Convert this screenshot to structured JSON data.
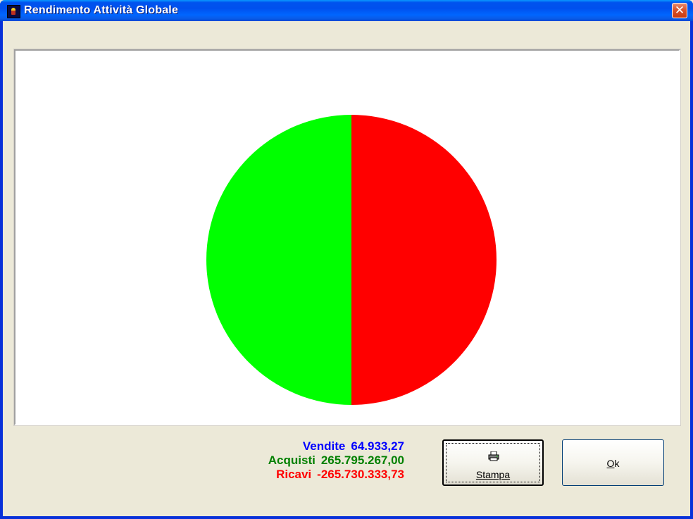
{
  "window": {
    "title": "Rendimento Attività Globale",
    "close_glyph": "✕",
    "colors": {
      "titlebar": "#0050ee",
      "frame": "#0831d9",
      "face": "#ece9d8"
    }
  },
  "chart_data": {
    "type": "pie",
    "labels": [
      "Ricavi",
      "Acquisti"
    ],
    "values": [
      0.5,
      0.5
    ],
    "colors": [
      "#ff0000",
      "#00ff00"
    ]
  },
  "legend": {
    "vendite": {
      "label": "Vendite",
      "value": "64.933,27",
      "color": "#0000ff"
    },
    "acquisti": {
      "label": "Acquisti",
      "value": "265.795.267,00",
      "color": "#008000"
    },
    "ricavi": {
      "label": "Ricavi",
      "value": "-265.730.333,73",
      "color": "#ff0000"
    }
  },
  "buttons": {
    "stampa": {
      "label": "Stampa",
      "icon": "printer-icon"
    },
    "ok": {
      "label_hotkey": "O",
      "label_rest": "k"
    }
  }
}
